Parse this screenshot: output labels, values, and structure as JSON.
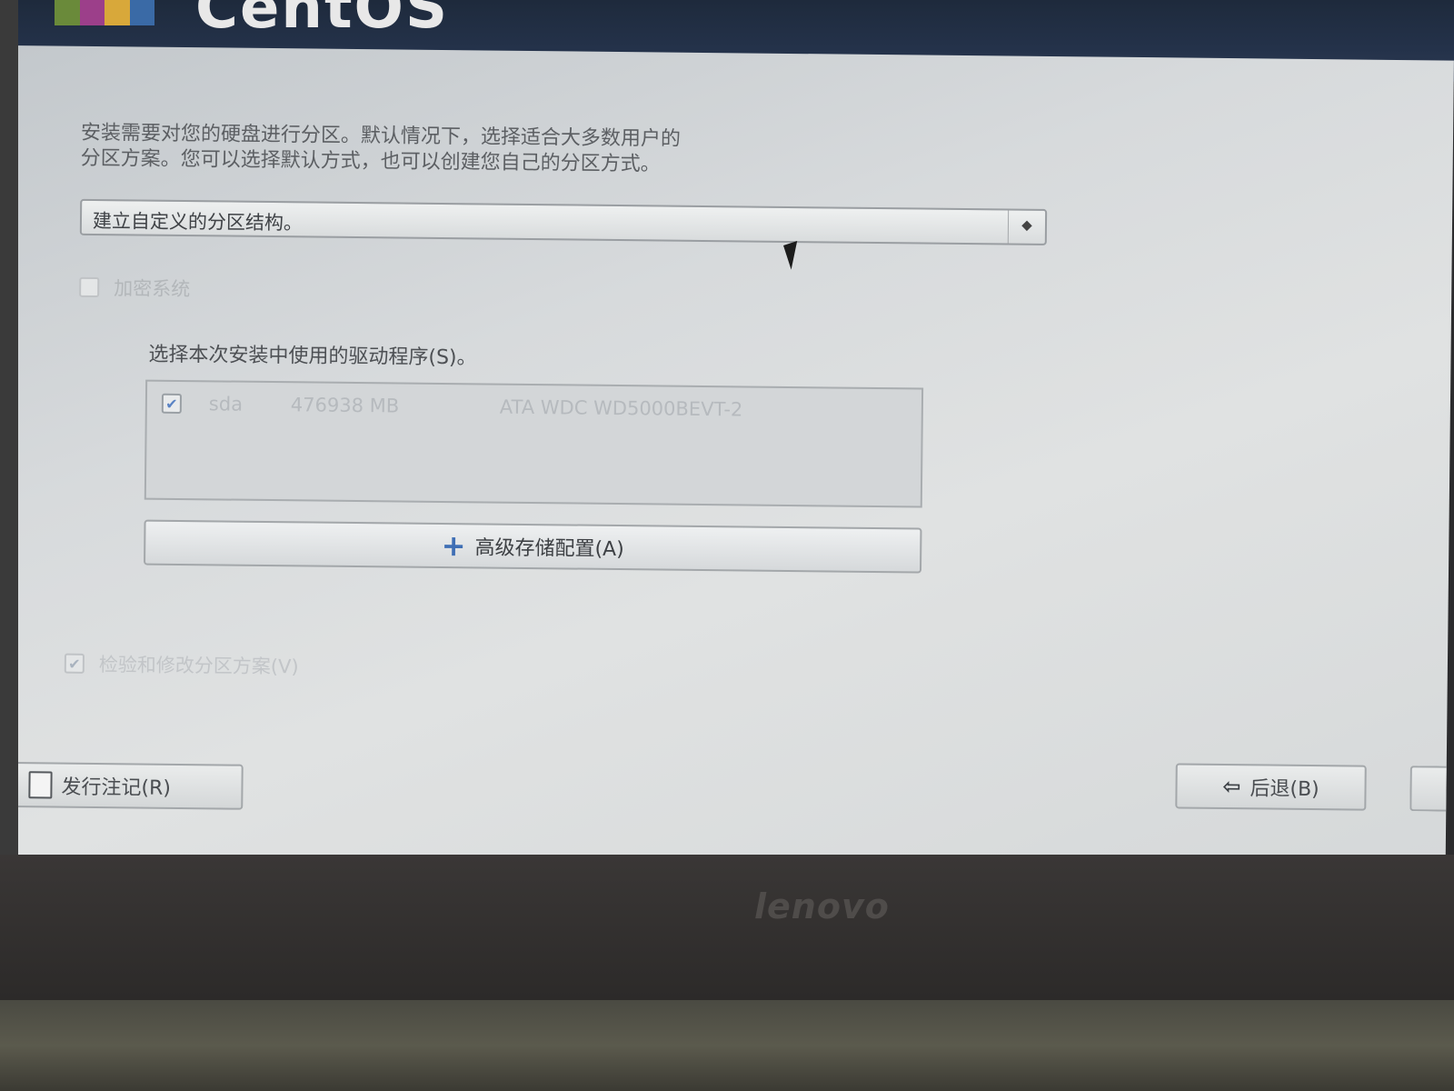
{
  "header": {
    "os_title": "CentOS"
  },
  "partition": {
    "intro_lines": [
      "安装需要对您的硬盘进行分区。默认情况下，选择适合大多数用户的",
      "分区方案。您可以选择默认方式，也可以创建您自己的分区方式。"
    ],
    "layout_select": {
      "selected": "建立自定义的分区结构。"
    },
    "encrypt_checkbox": {
      "label": "加密系统",
      "checked": false,
      "enabled": false
    },
    "drives_label": "选择本次安装中使用的驱动程序(S)。",
    "drives": [
      {
        "checked": true,
        "name": "sda",
        "size": "476938 MB",
        "model": "ATA WDC WD5000BEVT-2"
      }
    ],
    "advanced_storage_button": "高级存储配置(A)",
    "review_checkbox": {
      "label": "检验和修改分区方案(V)",
      "checked": true,
      "enabled": false
    }
  },
  "footer": {
    "release_notes_button": "发行注记(R)",
    "back_button": "后退(B)"
  },
  "device": {
    "brand": "lenovo"
  },
  "icons": {
    "combo_arrow": "updown-arrow-icon",
    "add": "plus-icon",
    "release_notes": "document-icon",
    "back": "back-arrow-icon",
    "checkmark": "check-icon"
  },
  "colors": {
    "accent": "#3f6fb5",
    "screen_bg": "#d7dadc"
  }
}
